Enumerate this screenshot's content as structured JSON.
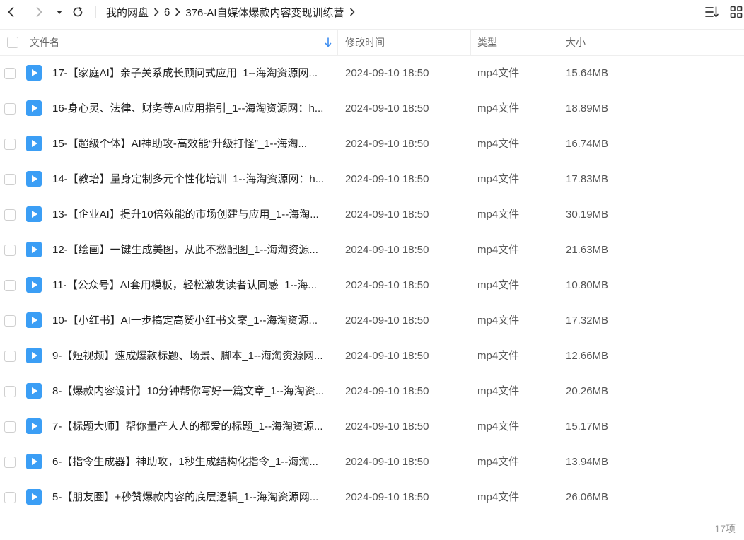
{
  "breadcrumb": [
    {
      "label": "我的网盘"
    },
    {
      "label": "6"
    },
    {
      "label": "376-AI自媒体爆款内容变现训练营"
    }
  ],
  "columns": {
    "name": "文件名",
    "modified": "修改时间",
    "type": "类型",
    "size": "大小"
  },
  "files": [
    {
      "name": "17-【家庭AI】亲子关系成长顾问式应用_1--海淘资源网...",
      "modified": "2024-09-10 18:50",
      "type": "mp4文件",
      "size": "15.64MB"
    },
    {
      "name": "16-身心灵、法律、财务等AI应用指引_1--海淘资源网：h...",
      "modified": "2024-09-10 18:50",
      "type": "mp4文件",
      "size": "18.89MB"
    },
    {
      "name": "15-【超级个体】AI神助攻-高效能“升级打怪”_1--海淘...",
      "modified": "2024-09-10 18:50",
      "type": "mp4文件",
      "size": "16.74MB"
    },
    {
      "name": "14-【教培】量身定制多元个性化培训_1--海淘资源网：h...",
      "modified": "2024-09-10 18:50",
      "type": "mp4文件",
      "size": "17.83MB"
    },
    {
      "name": "13-【企业AI】提升10倍效能的市场创建与应用_1--海淘...",
      "modified": "2024-09-10 18:50",
      "type": "mp4文件",
      "size": "30.19MB"
    },
    {
      "name": "12-【绘画】一键生成美图，从此不愁配图_1--海淘资源...",
      "modified": "2024-09-10 18:50",
      "type": "mp4文件",
      "size": "21.63MB"
    },
    {
      "name": "11-【公众号】AI套用模板，轻松激发读者认同感_1--海...",
      "modified": "2024-09-10 18:50",
      "type": "mp4文件",
      "size": "10.80MB"
    },
    {
      "name": "10-【小红书】AI一步搞定高赞小红书文案_1--海淘资源...",
      "modified": "2024-09-10 18:50",
      "type": "mp4文件",
      "size": "17.32MB"
    },
    {
      "name": "9-【短视频】速成爆款标题、场景、脚本_1--海淘资源网...",
      "modified": "2024-09-10 18:50",
      "type": "mp4文件",
      "size": "12.66MB"
    },
    {
      "name": "8-【爆款内容设计】10分钟帮你写好一篇文章_1--海淘资...",
      "modified": "2024-09-10 18:50",
      "type": "mp4文件",
      "size": "20.26MB"
    },
    {
      "name": "7-【标题大师】帮你量产人人的都爱的标题_1--海淘资源...",
      "modified": "2024-09-10 18:50",
      "type": "mp4文件",
      "size": "15.17MB"
    },
    {
      "name": "6-【指令生成器】神助攻，1秒生成结构化指令_1--海淘...",
      "modified": "2024-09-10 18:50",
      "type": "mp4文件",
      "size": "13.94MB"
    },
    {
      "name": "5-【朋友圈】+秒赞爆款内容的底层逻辑_1--海淘资源网...",
      "modified": "2024-09-10 18:50",
      "type": "mp4文件",
      "size": "26.06MB"
    }
  ],
  "footer": {
    "count": "17项"
  },
  "colors": {
    "accent": "#3b8cf0",
    "file_icon": "#3b9ef5"
  },
  "icons": {
    "back": "chevron-left-icon",
    "forward": "chevron-right-icon",
    "dropdown": "caret-down-icon",
    "refresh": "refresh-icon",
    "sort": "sort-list-icon",
    "grid": "grid-view-icon",
    "file": "video-file-icon"
  }
}
